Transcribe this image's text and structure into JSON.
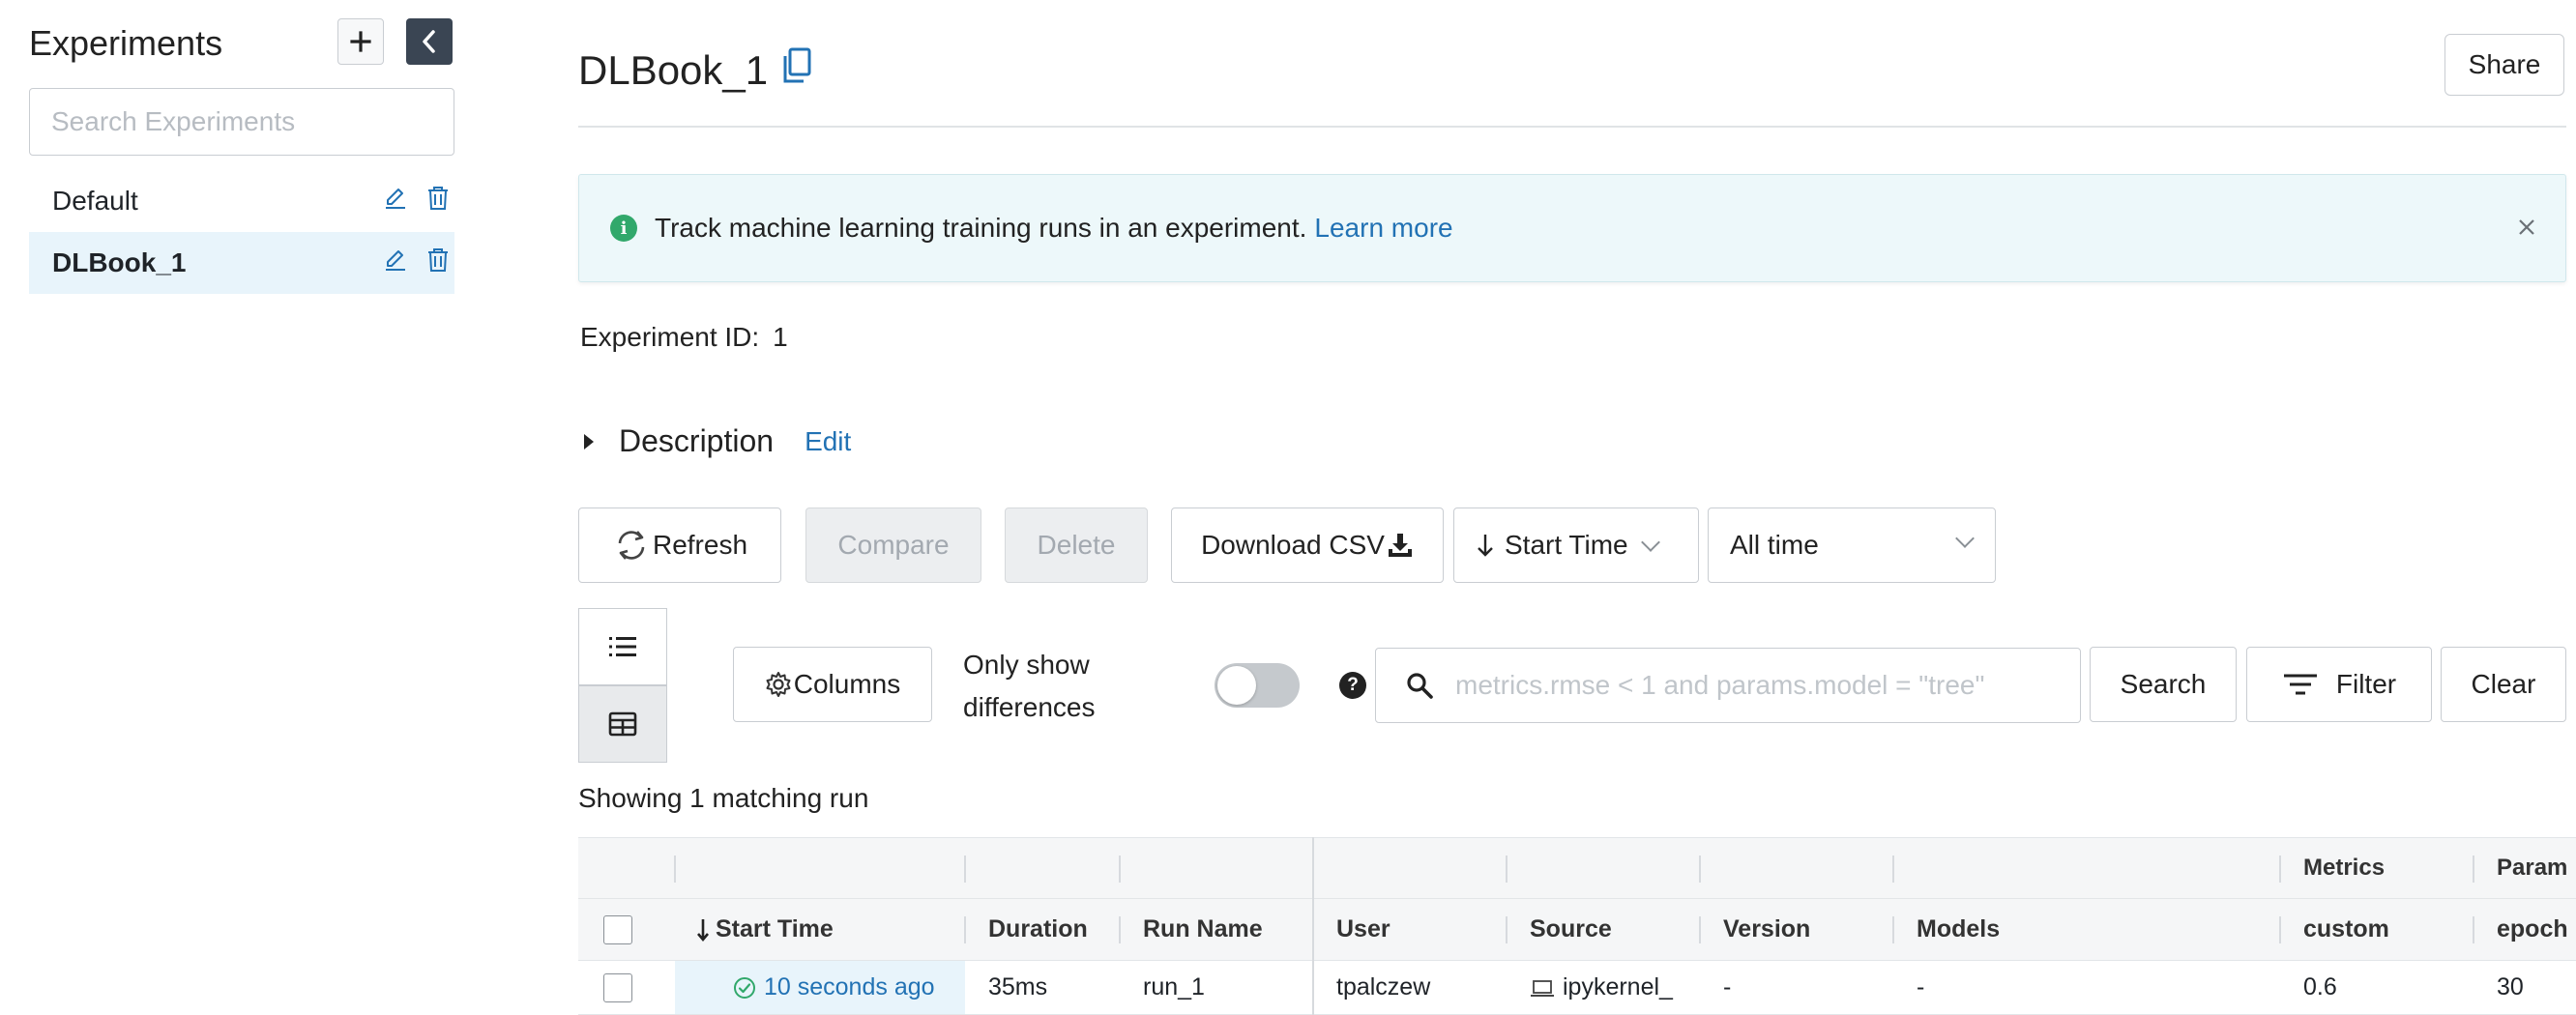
{
  "sidebar": {
    "title": "Experiments",
    "search_placeholder": "Search Experiments",
    "items": [
      {
        "label": "Default",
        "active": false
      },
      {
        "label": "DLBook_1",
        "active": true
      }
    ]
  },
  "header": {
    "title": "DLBook_1",
    "share_label": "Share"
  },
  "banner": {
    "text": "Track machine learning training runs in an experiment.",
    "link": "Learn more"
  },
  "experiment": {
    "id_label": "Experiment ID:",
    "id_value": "1"
  },
  "description": {
    "label": "Description",
    "edit_label": "Edit"
  },
  "toolbar": {
    "refresh_label": "Refresh",
    "compare_label": "Compare",
    "delete_label": "Delete",
    "download_label": "Download CSV",
    "sort_label": "Start Time",
    "time_range_label": "All time",
    "columns_label": "Columns",
    "only_diff_line1": "Only show",
    "only_diff_line2": "differences",
    "only_diff_on": false,
    "search_placeholder": "metrics.rmse < 1 and params.model = \"tree\"",
    "search_label": "Search",
    "filter_label": "Filter",
    "clear_label": "Clear"
  },
  "results": {
    "summary": "Showing 1 matching run"
  },
  "table": {
    "group_headers": {
      "metrics": "Metrics",
      "params": "Param"
    },
    "columns": [
      "Start Time",
      "Duration",
      "Run Name",
      "User",
      "Source",
      "Version",
      "Models",
      "custom",
      "epoch"
    ],
    "rows": [
      {
        "start_time": "10 seconds ago",
        "duration": "35ms",
        "run_name": "run_1",
        "user": "tpalczew",
        "source": "ipykernel_",
        "version": "-",
        "models": "-",
        "custom": "0.6",
        "epoch": "30"
      }
    ]
  },
  "colors": {
    "accent": "#2272b4",
    "banner_bg": "#edf8fa",
    "success": "#31a86b",
    "sidebar_active": "#e8f4fb",
    "collapse_btn": "#3a4553"
  }
}
